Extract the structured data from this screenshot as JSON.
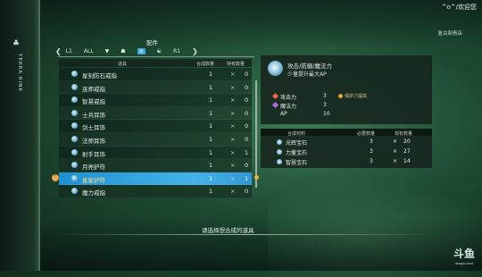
{
  "top_right": {
    "text": "^o^/欢迎您",
    "sub": "复古刺青店"
  },
  "sidebar": {
    "logo": "♣",
    "vertical_text": "TERRA RINK"
  },
  "panel": {
    "title": "配件",
    "tabs": [
      "L1",
      "ALL",
      "▼",
      "☗",
      "⊘",
      "☯",
      "R1"
    ],
    "active_tab": 4,
    "headers": {
      "name": "道具",
      "qty": "合成数量",
      "owned": "持有数量"
    },
    "rows": [
      {
        "name": "星刻防石戒指",
        "qty": "1",
        "x": "×",
        "owned": "0"
      },
      {
        "name": "巫师戒指",
        "qty": "1",
        "x": "×",
        "owned": "0"
      },
      {
        "name": "智慧戒指",
        "qty": "1",
        "x": "×",
        "owned": "0"
      },
      {
        "name": "士兵耳饰",
        "qty": "1",
        "x": "×",
        "owned": "0"
      },
      {
        "name": "剑士耳饰",
        "qty": "1",
        "x": "×",
        "owned": "0"
      },
      {
        "name": "法师耳饰",
        "qty": "1",
        "x": "×",
        "owned": "0"
      },
      {
        "name": "射手耳饰",
        "qty": "1",
        "x": "×",
        "owned": "1"
      },
      {
        "name": "月亮护符",
        "qty": "1",
        "x": "×",
        "owned": "0"
      },
      {
        "name": "星星护符",
        "qty": "1",
        "x": "×",
        "owned": "1",
        "selected": true
      },
      {
        "name": "魔力戒指",
        "qty": "1",
        "x": "×",
        "owned": "0"
      }
    ]
  },
  "detail": {
    "name": "攻击/防御/魔法力",
    "desc": "少量提升最大AP",
    "stats": [
      {
        "label": "攻击力",
        "value": "3",
        "color": "#e36a4a"
      },
      {
        "label": "魔法力",
        "value": "3",
        "color": "#b06ad8"
      },
      {
        "label": "AP",
        "value": "10",
        "color": "#7fc6e8"
      }
    ],
    "bonus": "保护力提高"
  },
  "materials": {
    "headers": {
      "name": "合成材料",
      "need": "必要数量",
      "owned": "现有数量"
    },
    "rows": [
      {
        "name": "光辉宝石",
        "need": "3",
        "x": "×",
        "owned": "20"
      },
      {
        "name": "力量宝石",
        "need": "3",
        "x": "×",
        "owned": "27"
      },
      {
        "name": "智慧宝石",
        "need": "3",
        "x": "×",
        "owned": "14"
      }
    ]
  },
  "hint": "请选择想合成的道具",
  "watermark": {
    "main": "斗鱼",
    "sub": "douyu.com"
  }
}
